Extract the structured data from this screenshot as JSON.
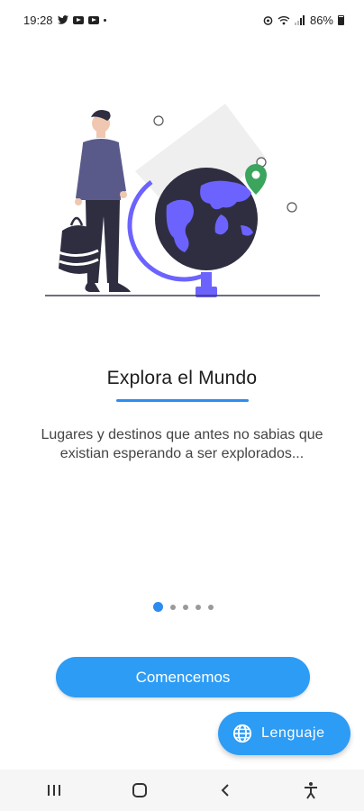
{
  "status_bar": {
    "time": "19:28",
    "battery": "86%",
    "icons": [
      "twitter-icon",
      "youtube-icon",
      "youtube-icon",
      "notification-dot",
      "alarm-icon",
      "wifi-icon",
      "signal-icon",
      "battery-icon"
    ]
  },
  "onboarding": {
    "title": "Explora el Mundo",
    "description": "Lugares y destinos que antes no sabias que existian esperando a ser explorados...",
    "page_count": 5,
    "current_page": 1
  },
  "buttons": {
    "start_label": "Comencemos",
    "language_label": "Lenguaje",
    "language_icon": "globe-icon"
  },
  "nav_bar": {
    "icons": [
      "recents-icon",
      "home-icon",
      "back-icon",
      "accessibility-icon"
    ]
  },
  "colors": {
    "accent": "#2d9cf5",
    "underline": "#2d8cf0",
    "globe": "#2f2e41",
    "globe_ring": "#6c63ff",
    "pin": "#3ba55d"
  }
}
